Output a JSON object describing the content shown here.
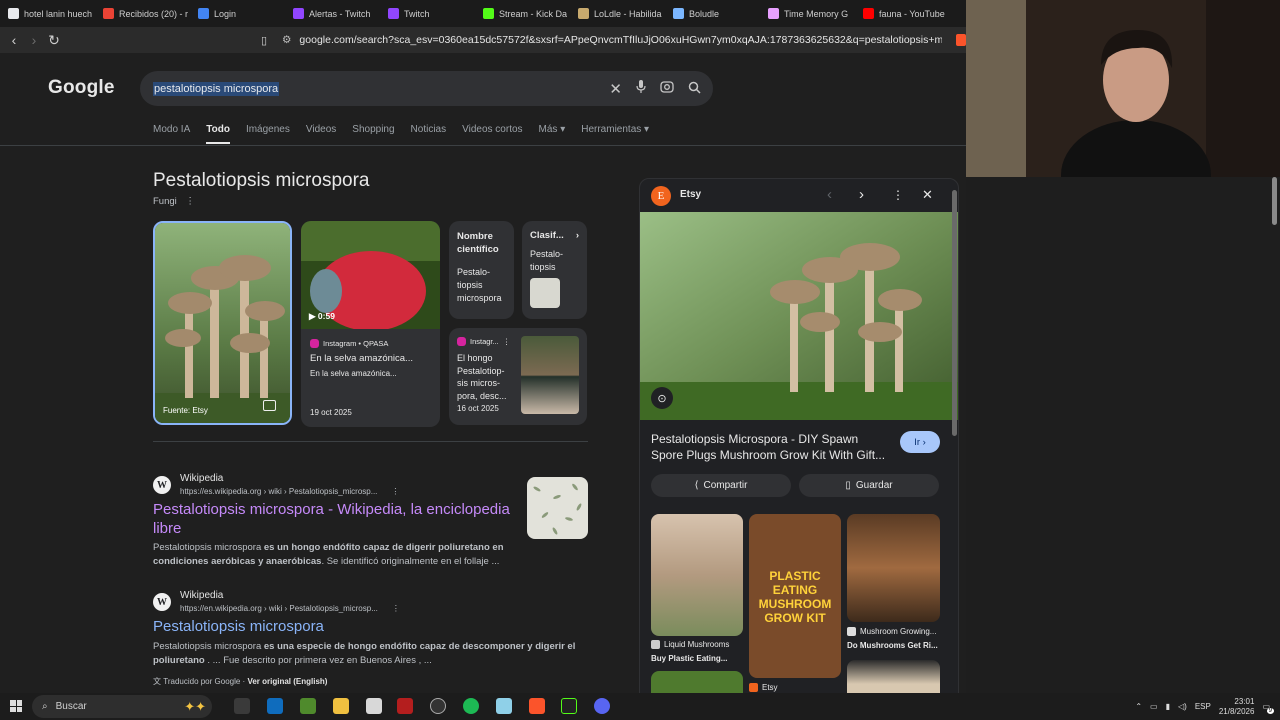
{
  "tabs": [
    {
      "label": "hotel lanin huech",
      "color": "#e8eaed"
    },
    {
      "label": "Recibidos (20) - r",
      "color": "#ea4335"
    },
    {
      "label": "Login",
      "color": "#4285f4"
    },
    {
      "label": "Alertas - Twitch",
      "color": "#9146ff"
    },
    {
      "label": "Twitch",
      "color": "#9146ff"
    },
    {
      "label": "Stream - Kick Da",
      "color": "#53fc18"
    },
    {
      "label": "LoLdle - Habilida",
      "color": "#c8aa6e"
    },
    {
      "label": "Boludle",
      "color": "#7bb7ff"
    },
    {
      "label": "Time Memory G",
      "color": "#e8a0ff"
    },
    {
      "label": "fauna - YouTube",
      "color": "#ff0000"
    }
  ],
  "address": {
    "url": "google.com/search?sca_esv=0360ea15dc57572f&sxsrf=APpeQnvcmTfIluJjO06xuHGwn7ym0xqAJA:1787363625632&q=pestalotiopsis+microspora&sourc..."
  },
  "google": {
    "logo": "Google",
    "query": "pestalotiopsis microspora",
    "tabs": [
      "Modo IA",
      "Todo",
      "Imágenes",
      "Videos",
      "Shopping",
      "Noticias",
      "Videos cortos",
      "Más ▾",
      "Herramientas ▾"
    ],
    "active_tab": "Todo"
  },
  "knowledge": {
    "title": "Pestalotiopsis microspora",
    "subtitle": "Fungi",
    "main_image_caption": "Fuente: Etsy",
    "video": {
      "duration": "0:59",
      "source": "Instagram • QPASA",
      "title": "En la selva amazónica...",
      "desc": "En la selva amazónica...",
      "date": "19 oct 2025"
    },
    "sci_name": {
      "label": "Nombre científico",
      "value": "Pestalo-tiopsis microspora"
    },
    "classif": {
      "label": "Clasif...",
      "value": "Pestalo-tiopsis"
    },
    "insta": {
      "source": "Instagr...",
      "title": "El hongo Pestalotiop-sis micros-pora, desc...",
      "date": "16 oct 2025"
    }
  },
  "results": [
    {
      "site": "Wikipedia",
      "url": "https://es.wikipedia.org › wiki › Pestalotiopsis_microsp...",
      "title": "Pestalotiopsis microspora - Wikipedia, la enciclopedia libre",
      "snippet_pre": "Pestalotiopsis microspora ",
      "snippet_bold": "es un hongo endófito capaz de digerir poliuretano en condiciones aeróbicas y anaeróbicas",
      "snippet_post": ". Se identificó originalmente en el follaje ..."
    },
    {
      "site": "Wikipedia",
      "url": "https://en.wikipedia.org › wiki › Pestalotiopsis_microsp...",
      "title": "Pestalotiopsis microspora",
      "snippet_pre": "Pestalotiopsis microspora ",
      "snippet_bold": "es una especie de hongo endófito capaz de descomponer y digerir el poliuretano",
      "snippet_post": " . ... Fue descrito por primera vez en Buenos Aires , ...",
      "translated": "Traducido por Google ·",
      "original": "Ver original (English)"
    }
  ],
  "panel": {
    "source": "Etsy",
    "title": "Pestalotiopsis Microspora - DIY Spawn Spore Plugs Mushroom Grow Kit With Gift...",
    "go": "Ir ›",
    "share": "Compartir",
    "save": "Guardar",
    "related": [
      {
        "src": "Liquid Mushrooms",
        "title": "Buy Plastic Eating..."
      },
      {
        "src": "",
        "title": "PLASTIC EATING MUSHROOM GROW KIT"
      },
      {
        "src": "Mushroom Growing...",
        "title": "Do Mushrooms Get Ri..."
      }
    ],
    "related_etsy": "Etsy"
  },
  "taskbar": {
    "search": "Buscar",
    "lang": "ESP",
    "time": "23:01",
    "date": "21/8/2026",
    "notif": "9"
  }
}
